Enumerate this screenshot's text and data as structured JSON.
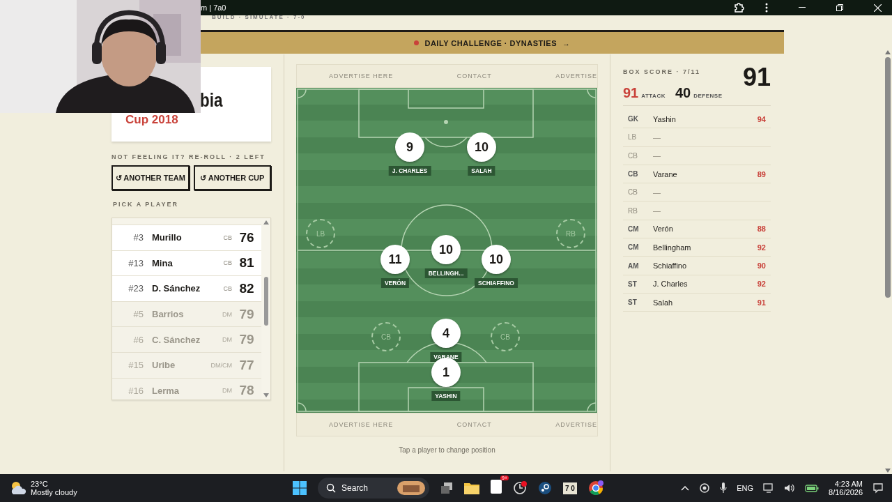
{
  "window": {
    "title": "m | 7a0"
  },
  "header": {
    "tagline": "BUILD · SIMULATE · 7-0"
  },
  "banner": {
    "text": "DAILY CHALLENGE · DYNASTIES",
    "arrow": "→"
  },
  "team_card": {
    "title": "bia",
    "subtitle": "Cup 2018"
  },
  "reroll": {
    "label": "NOT FEELING IT? RE-ROLL · 2 LEFT",
    "buttons": [
      {
        "icon": "↺",
        "label": "ANOTHER TEAM"
      },
      {
        "icon": "↺",
        "label": "ANOTHER CUP"
      }
    ]
  },
  "pick_label": "PICK A PLAYER",
  "players": [
    {
      "number": "#3",
      "name": "Murillo",
      "position": "CB",
      "rating": "76",
      "disabled": false
    },
    {
      "number": "#13",
      "name": "Mina",
      "position": "CB",
      "rating": "81",
      "disabled": false
    },
    {
      "number": "#23",
      "name": "D. Sánchez",
      "position": "CB",
      "rating": "82",
      "disabled": false
    },
    {
      "number": "#5",
      "name": "Barrios",
      "position": "DM",
      "rating": "79",
      "disabled": true
    },
    {
      "number": "#6",
      "name": "C. Sánchez",
      "position": "DM",
      "rating": "79",
      "disabled": true
    },
    {
      "number": "#15",
      "name": "Uribe",
      "position": "DM/CM",
      "rating": "77",
      "disabled": true
    },
    {
      "number": "#16",
      "name": "Lerma",
      "position": "DM",
      "rating": "78",
      "disabled": true
    }
  ],
  "ads_top": [
    "ADVERTISE HERE",
    "CONTACT",
    "ADVERTISE"
  ],
  "pitch": {
    "slots": [
      {
        "kind": "player",
        "number": "9",
        "name": "J. CHARLES"
      },
      {
        "kind": "player",
        "number": "10",
        "name": "SALAH"
      },
      {
        "kind": "empty",
        "label": "LB"
      },
      {
        "kind": "empty",
        "label": "RB"
      },
      {
        "kind": "player",
        "number": "10",
        "name": "BELLINGH..."
      },
      {
        "kind": "player",
        "number": "11",
        "name": "VERÓN"
      },
      {
        "kind": "player",
        "number": "10",
        "name": "SCHIAFFINO"
      },
      {
        "kind": "empty",
        "label": "CB"
      },
      {
        "kind": "player",
        "number": "4",
        "name": "VARANE"
      },
      {
        "kind": "empty",
        "label": "CB"
      },
      {
        "kind": "player",
        "number": "1",
        "name": "YASHIN"
      }
    ]
  },
  "ads_bottom": [
    "ADVERTISE HERE",
    "CONTACT",
    "ADVERTISE"
  ],
  "hint": "Tap a player to change position",
  "box_score": {
    "label": "BOX SCORE · 7/11",
    "total": "91",
    "attack": "91",
    "attack_label": "ATTACK",
    "defense": "40",
    "defense_label": "DEFENSE",
    "rows": [
      {
        "position": "GK",
        "name": "Yashin",
        "rating": "94",
        "filled": true
      },
      {
        "position": "LB",
        "name": "—",
        "filled": false
      },
      {
        "position": "CB",
        "name": "—",
        "filled": false
      },
      {
        "position": "CB",
        "name": "Varane",
        "rating": "89",
        "filled": true
      },
      {
        "position": "CB",
        "name": "—",
        "filled": false
      },
      {
        "position": "RB",
        "name": "—",
        "filled": false
      },
      {
        "position": "CM",
        "name": "Verón",
        "rating": "88",
        "filled": true
      },
      {
        "position": "CM",
        "name": "Bellingham",
        "rating": "92",
        "filled": true
      },
      {
        "position": "AM",
        "name": "Schiaffino",
        "rating": "90",
        "filled": true
      },
      {
        "position": "ST",
        "name": "J. Charles",
        "rating": "92",
        "filled": true
      },
      {
        "position": "ST",
        "name": "Salah",
        "rating": "91",
        "filled": true
      }
    ]
  },
  "taskbar": {
    "weather": {
      "temp": "23°C",
      "condition": "Mostly cloudy"
    },
    "search": "Search",
    "notes_badge": "9+",
    "app_label": "7 0",
    "language": "ENG",
    "time": "4:23 AM",
    "date": "8/16/2026"
  }
}
